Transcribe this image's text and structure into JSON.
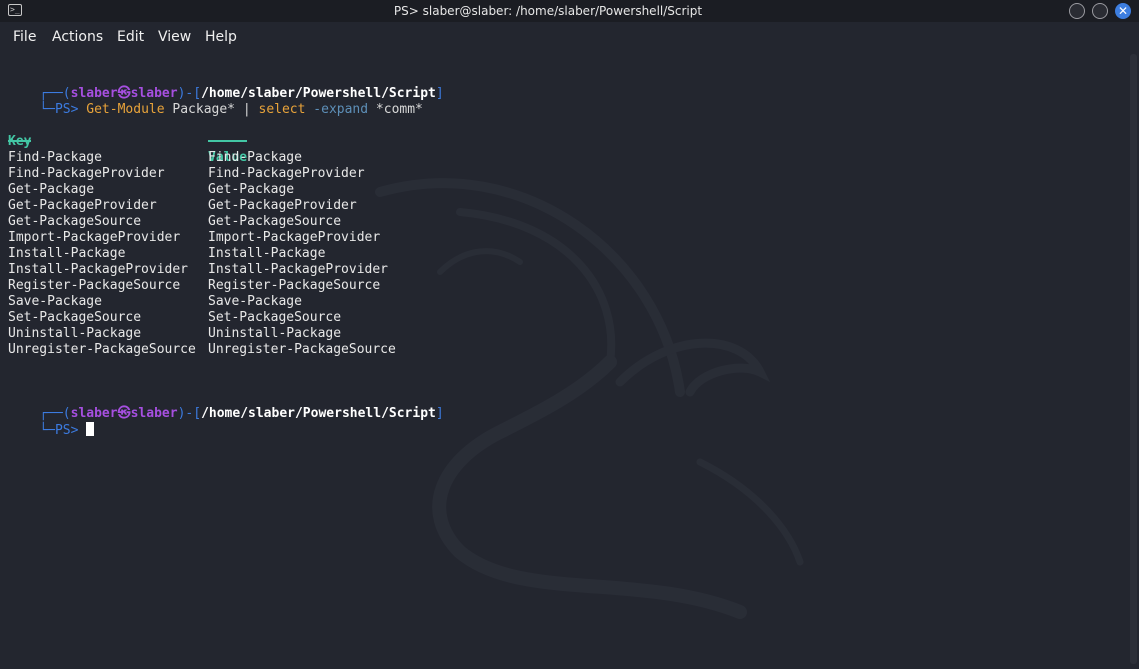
{
  "window": {
    "title": "PS> slaber@slaber: /home/slaber/Powershell/Script",
    "app_icon": "terminal-icon",
    "close_glyph": "✕"
  },
  "menu": [
    "File",
    "Actions",
    "Edit",
    "View",
    "Help"
  ],
  "colors": {
    "background": "#23262f",
    "prompt_frame": "#3c7be0",
    "user_host": "#a64fe0",
    "path": "#ffffff",
    "command": "#e8a33a",
    "parameter": "#5d8fb8",
    "header": "#43c7a5",
    "close_button": "#3d7ee0"
  },
  "prompt1": {
    "frame_top": "┌──(",
    "user": "slaber",
    "at_symbol": "㉿",
    "host": "slaber",
    "sep": ")-[",
    "path": "/home/slaber/Powershell/Script",
    "close": "]",
    "frame_bottom": "└─",
    "ps": "PS>",
    "cmd": "Get-Module",
    "arg1": "Package*",
    "pipe": "|",
    "cmd2": "select",
    "param": "-expand",
    "arg2": "*comm*"
  },
  "table": {
    "headers": [
      "Key",
      "Value"
    ],
    "rows": [
      [
        "Find-Package",
        "Find-Package"
      ],
      [
        "Find-PackageProvider",
        "Find-PackageProvider"
      ],
      [
        "Get-Package",
        "Get-Package"
      ],
      [
        "Get-PackageProvider",
        "Get-PackageProvider"
      ],
      [
        "Get-PackageSource",
        "Get-PackageSource"
      ],
      [
        "Import-PackageProvider",
        "Import-PackageProvider"
      ],
      [
        "Install-Package",
        "Install-Package"
      ],
      [
        "Install-PackageProvider",
        "Install-PackageProvider"
      ],
      [
        "Register-PackageSource",
        "Register-PackageSource"
      ],
      [
        "Save-Package",
        "Save-Package"
      ],
      [
        "Set-PackageSource",
        "Set-PackageSource"
      ],
      [
        "Uninstall-Package",
        "Uninstall-Package"
      ],
      [
        "Unregister-PackageSource",
        "Unregister-PackageSource"
      ]
    ]
  },
  "prompt2": {
    "frame_top": "┌──(",
    "user": "slaber",
    "at_symbol": "㉿",
    "host": "slaber",
    "sep": ")-[",
    "path": "/home/slaber/Powershell/Script",
    "close": "]",
    "frame_bottom": "└─",
    "ps": "PS>"
  }
}
